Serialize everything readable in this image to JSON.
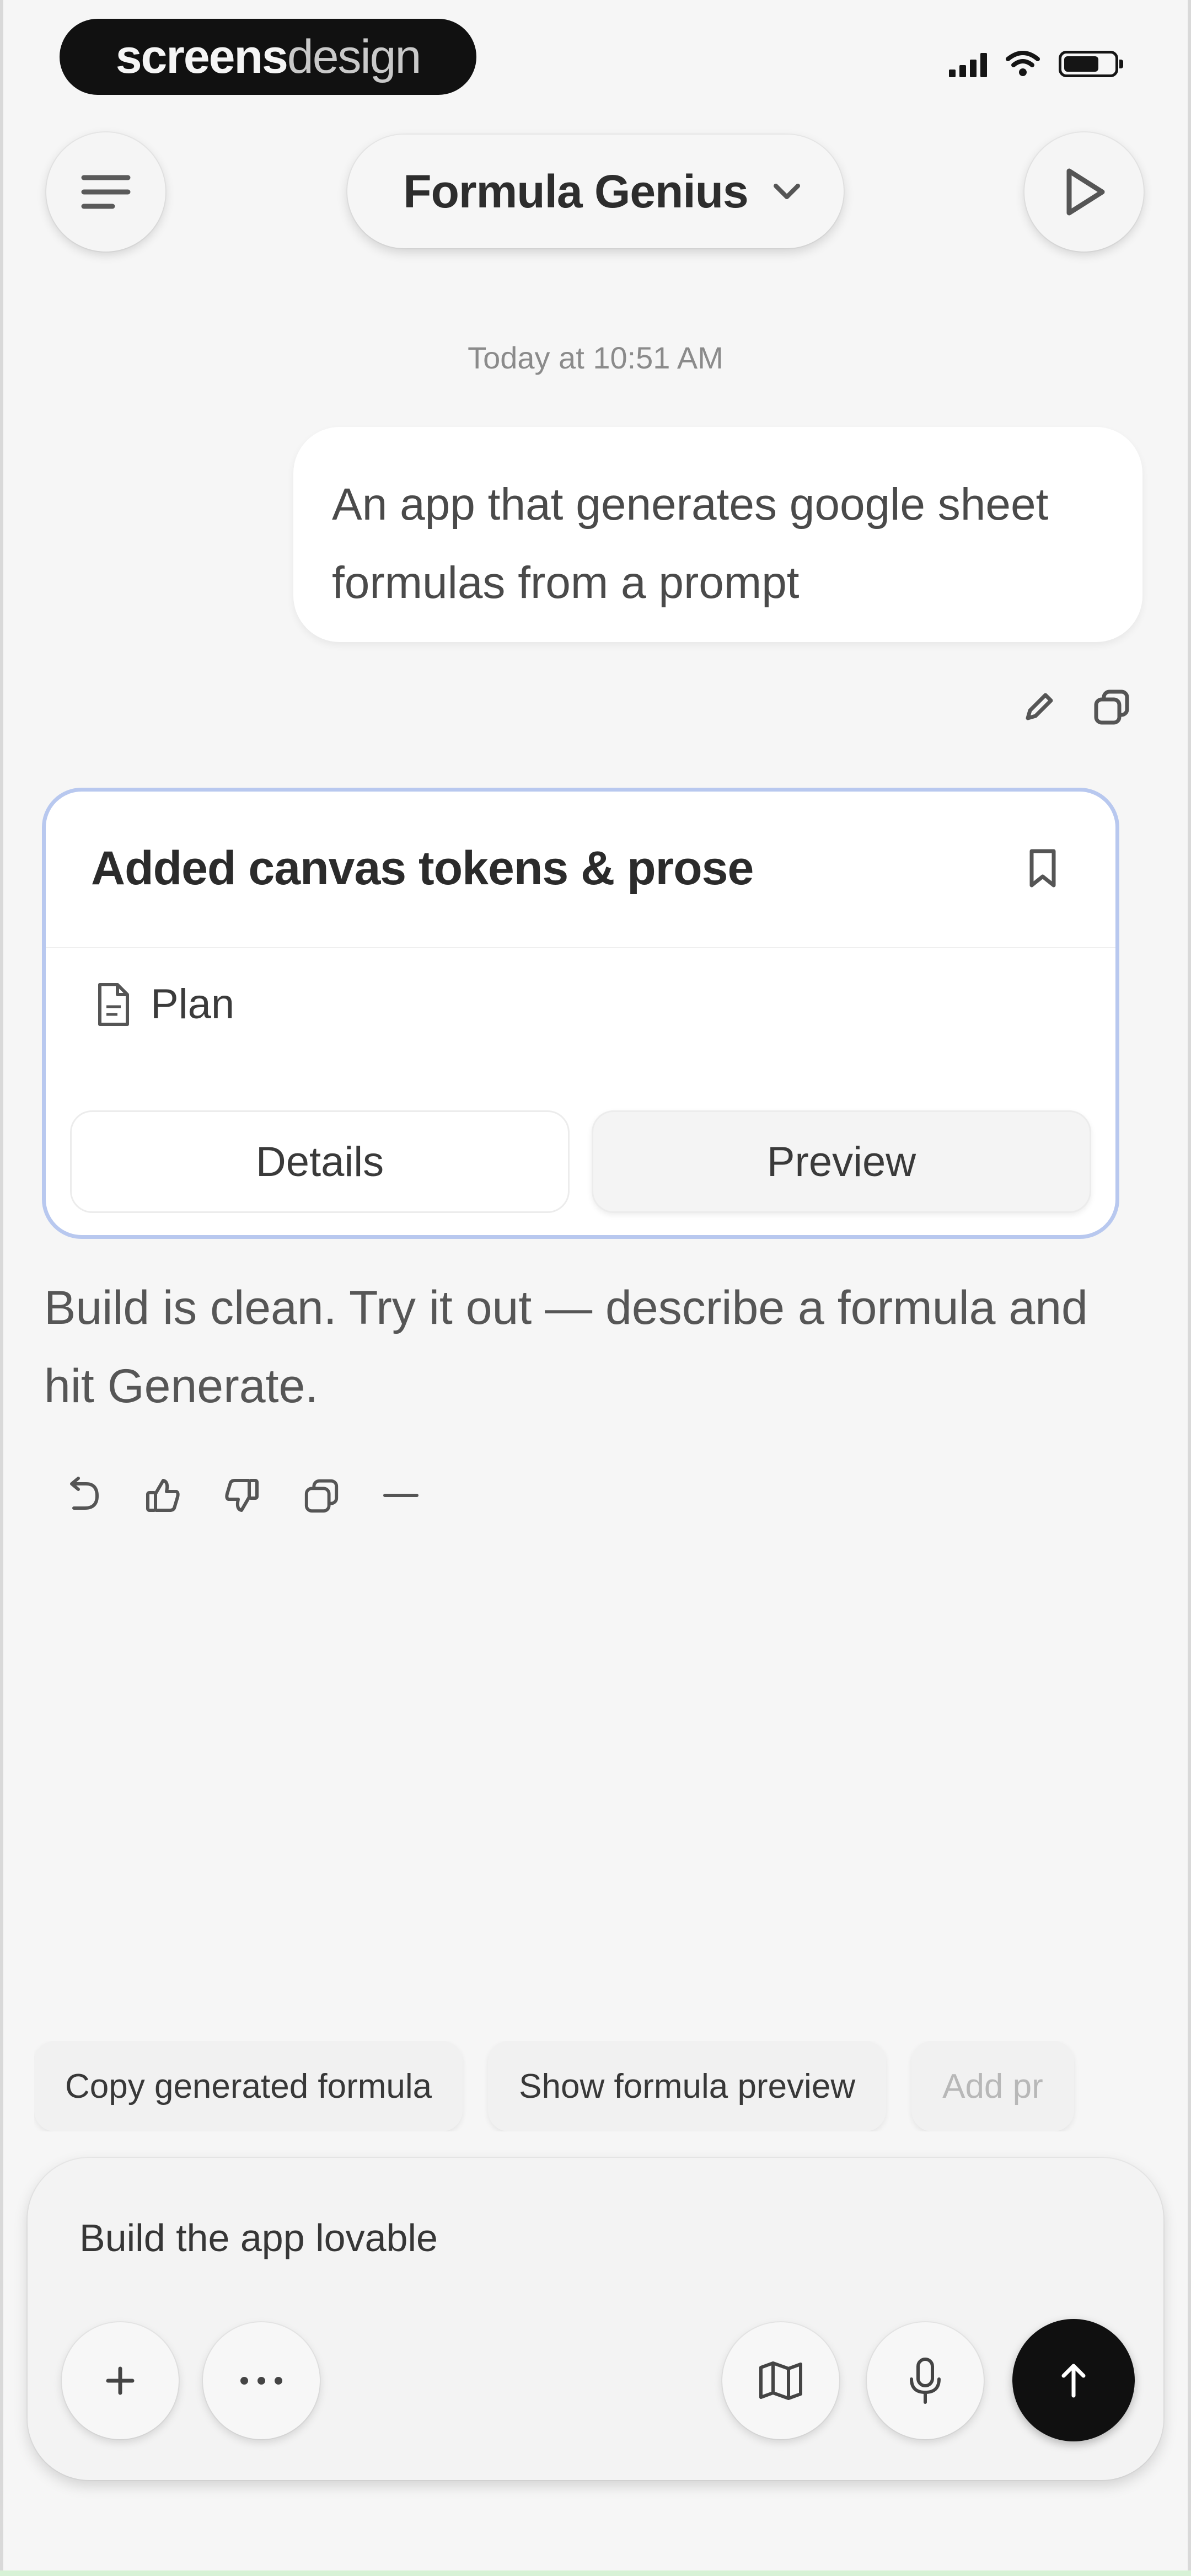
{
  "status_bar": {
    "brand_bold": "screens",
    "brand_light": "design"
  },
  "header": {
    "title": "Formula Genius",
    "menu_icon": "list-icon",
    "dropdown_icon": "chevron-down-icon",
    "play_icon": "play-icon"
  },
  "chat": {
    "timestamp": "Today at 10:51 AM",
    "user_message": "An app that generates google sheet formulas from a prompt",
    "user_actions": [
      "edit-icon",
      "copy-icon"
    ],
    "card": {
      "title": "Added canvas tokens & prose",
      "item_label": "Plan",
      "details_label": "Details",
      "preview_label": "Preview",
      "accent": "#b8c8ef"
    },
    "assistant_message": "Build is clean. Try it out — describe a formula and hit Generate.",
    "assistant_actions": [
      "undo-icon",
      "thumbs-up-icon",
      "thumbs-down-icon",
      "copy-icon",
      "more-icon"
    ]
  },
  "suggestions": [
    "Copy generated formula",
    "Show formula preview",
    "Add pr"
  ],
  "composer": {
    "input_value": "Build the app lovable",
    "send_color": "#101010"
  }
}
